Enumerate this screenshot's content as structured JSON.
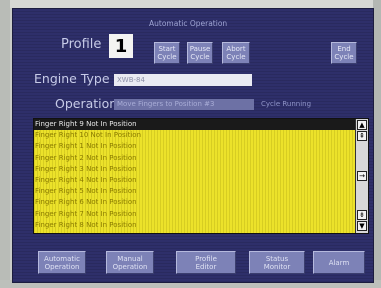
{
  "window": {
    "title": "Automatic Operation"
  },
  "profile": {
    "label": "Profile",
    "value": "1"
  },
  "cycle_buttons": {
    "start": "Start\nCycle",
    "pause": "Pause\nCycle",
    "abort": "Abort\nCycle",
    "end": "End\nCycle"
  },
  "engine": {
    "label": "Engine Type",
    "value": "XWB-84"
  },
  "operation": {
    "label": "Operation",
    "value": "Move Fingers to Position #3",
    "status": "Cycle Running"
  },
  "messages": [
    "Finger Right 9 Not In Position",
    "Finger Right 10 Not In Position",
    "Finger Right 1 Not In Position",
    "Finger Right 2 Not In Position",
    "Finger Right 3 Not In Position",
    "Finger Right 4 Not In Position",
    "Finger Right 5 Not In Position",
    "Finger Right 6 Not In Position",
    "Finger Right 7 Not In Position",
    "Finger Right 8 Not In Position"
  ],
  "scrollbar": {
    "top": "▲",
    "page_up": "⇞",
    "right": "→",
    "page_down": "⇟",
    "bottom": "▼"
  },
  "nav": {
    "automatic": "Automatic\nOperation",
    "manual": "Manual\nOperation",
    "profile": "Profile\nEditor",
    "status": "Status\nMonitor",
    "alarm": "Alarm"
  },
  "colors": {
    "screen_bg": "#2e2f6a",
    "button": "#7d82b7",
    "list_bg": "#ece22a",
    "list_text": "#8b7c00",
    "selected_bg": "#1a1a1a"
  }
}
